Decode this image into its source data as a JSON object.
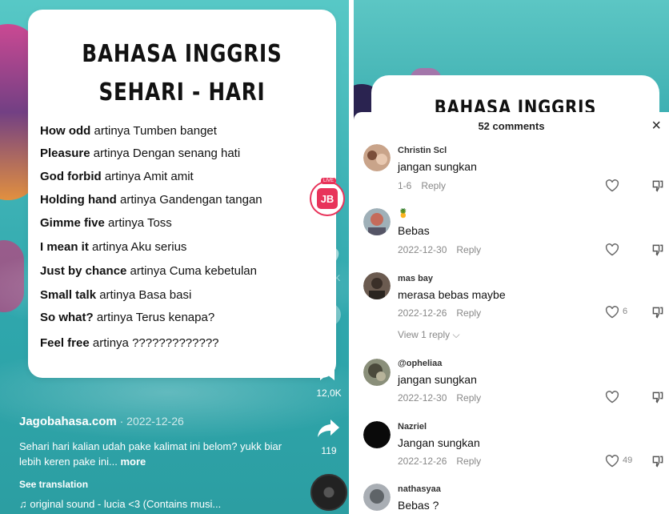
{
  "left": {
    "card": {
      "title_line1": "BAHASA INGGRIS",
      "title_line2": "SEHARI - HARI",
      "phrases": [
        {
          "en": "How odd",
          "mid": " artinya ",
          "id": "Tumben banget"
        },
        {
          "en": "Pleasure",
          "mid": " artinya ",
          "id": "Dengan senang hati"
        },
        {
          "en": "God forbid",
          "mid": " artinya ",
          "id": "Amit amit"
        },
        {
          "en": "Holding hand",
          "mid": " artinya ",
          "id": "Gandengan tangan"
        },
        {
          "en": "Gimme five",
          "mid": " artinya ",
          "id": "Toss"
        },
        {
          "en": "I mean it",
          "mid": " artinya ",
          "id": "Aku serius"
        },
        {
          "en": "Just by chance",
          "mid": " artinya ",
          "id": "Cuma kebetulan"
        },
        {
          "en": "Small talk",
          "mid": " artinya ",
          "id": "Basa basi"
        },
        {
          "en": "So what?",
          "mid": " artinya ",
          "id": "Terus kenapa?"
        },
        {
          "en": "Feel free",
          "mid": " artinya ",
          "id": "?????????????"
        }
      ]
    },
    "rail": {
      "live_tag": "LIVE",
      "live_initials": "JB",
      "likes": "32,3K",
      "comments": "52",
      "bookmarks": "12,0K",
      "shares": "119"
    },
    "author": "Jagobahasa.com",
    "date": " · 2022-12-26",
    "caption": "Sehari hari kalian udah pake kalimat ini belom? yukk biar lebih keren pake ini...",
    "more": " more",
    "see_translation": "See translation",
    "sound_icon": "♫",
    "sound": "original sound - lucia <3 (Contains musi..."
  },
  "right": {
    "peek_title": "BAHASA INGGRIS",
    "sheet_title": "52 comments",
    "close_label": "×",
    "reply_label": "Reply",
    "view_replies": "View 1 reply ⌵",
    "comments": [
      {
        "user": "Christin Scl",
        "text": "jangan sungkan",
        "date": "1-6",
        "likes": ""
      },
      {
        "user": "🍍",
        "text": "Bebas",
        "date": "2022-12-30",
        "likes": ""
      },
      {
        "user": "mas bay",
        "text": "merasa bebas maybe",
        "date": "2022-12-26",
        "likes": "6"
      },
      {
        "user": "@opheliaa",
        "text": "jangan sungkan",
        "date": "2022-12-30",
        "likes": ""
      },
      {
        "user": "Nazriel",
        "text": "Jangan sungkan",
        "date": "2022-12-26",
        "likes": "49"
      },
      {
        "user": "nathasyaa",
        "text": "Bebas ?",
        "date": "",
        "likes": ""
      }
    ],
    "colors": {
      "like_pink": "#e8335a",
      "muted": "#888888"
    }
  }
}
